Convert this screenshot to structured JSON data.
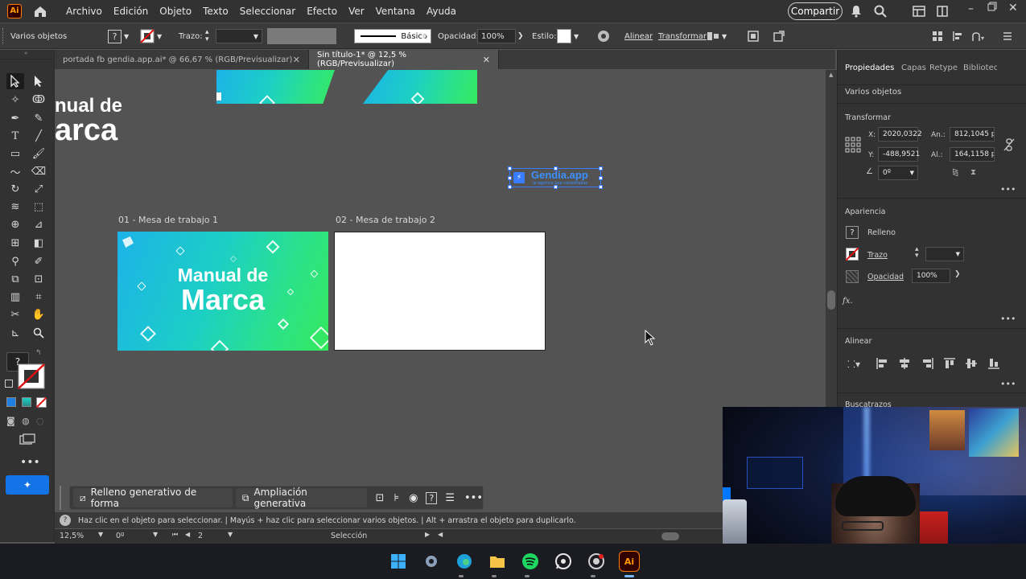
{
  "menubar": {
    "app_icon": "Ai",
    "items": [
      "Archivo",
      "Edición",
      "Objeto",
      "Texto",
      "Seleccionar",
      "Efecto",
      "Ver",
      "Ventana",
      "Ayuda"
    ],
    "share_label": "Compartir"
  },
  "controlbar": {
    "selection_label": "Varios objetos",
    "stroke_label": "Trazo:",
    "stroke_style": "Básico",
    "opacity_label": "Opacidad:",
    "opacity_value": "100%",
    "style_label": "Estilo:",
    "align_label": "Alinear",
    "transform_label": "Transformar"
  },
  "tabs": [
    {
      "label": "portada fb gendia.app.ai* @ 66,67 % (RGB/Previsualizar)",
      "active": false
    },
    {
      "label": "Sin título-1* @ 12,5 % (RGB/Previsualizar)",
      "active": true
    }
  ],
  "canvas": {
    "partial_title_1": "nual de",
    "partial_title_2": "arca",
    "artboard1_label": "01 - Mesa de trabajo 1",
    "artboard2_label": "02 - Mesa de trabajo 2",
    "artboard1_title_1": "Manual de",
    "artboard1_title_2": "Marca",
    "logo_text": "Gendia.app",
    "logo_subtext": "la agencia que necesitabas"
  },
  "context_bar": {
    "generative_fill_label": "Relleno generativo de forma",
    "generative_expand_label": "Ampliación generativa"
  },
  "panel": {
    "tabs": [
      "Propiedades",
      "Capas",
      "Retype",
      "Bibliotecas"
    ],
    "selection": "Varios objetos",
    "transform_title": "Transformar",
    "x_label": "X:",
    "x_value": "2020,0322",
    "y_label": "Y:",
    "y_value": "-488,9521",
    "w_label": "An.:",
    "w_value": "812,1045 p",
    "h_label": "Al.:",
    "h_value": "164,1158 p",
    "angle_value": "0º",
    "appearance_title": "Apariencia",
    "fill_label": "Relleno",
    "stroke_label": "Trazo",
    "opacity_label": "Opacidad",
    "opacity_value": "100%",
    "fx_label": "fx.",
    "align_title": "Alinear",
    "pathfinder_title": "Buscatrazos"
  },
  "status": {
    "hint": "Haz clic en el objeto para seleccionar.  |  Mayús + haz clic para seleccionar varios objetos.  |  Alt + arrastra el objeto para duplicarlo.",
    "zoom": "12,5%",
    "rotation": "0º",
    "artboard_number": "2",
    "tool_name": "Selección"
  },
  "colors": {
    "accent": "#1473e6",
    "ai_orange": "#ff9a00",
    "gradient_start": "#1cb3e8",
    "gradient_end": "#35e85d"
  }
}
